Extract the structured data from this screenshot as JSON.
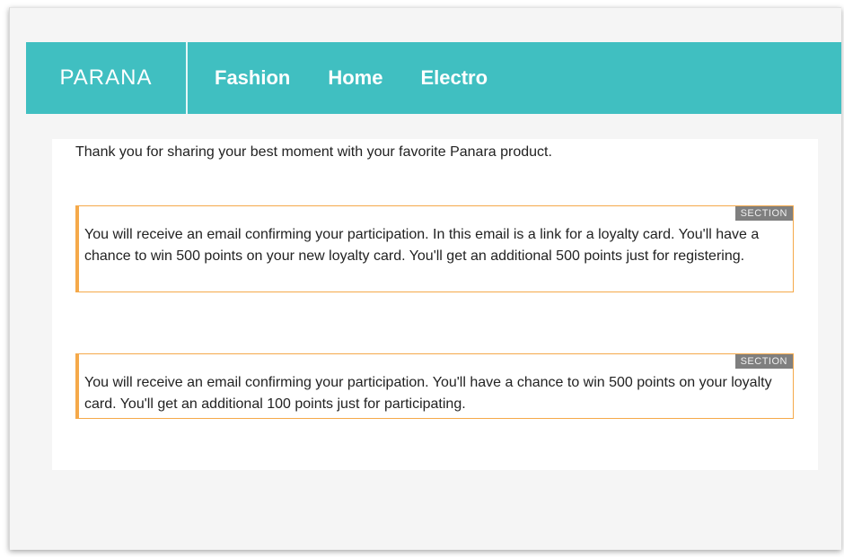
{
  "header": {
    "brand": "PARANA",
    "nav": [
      {
        "label": "Fashion"
      },
      {
        "label": "Home"
      },
      {
        "label": "Electro"
      }
    ]
  },
  "main": {
    "intro": "Thank you for sharing your best moment with your favorite Panara product.",
    "sections": [
      {
        "tag": "SECTION",
        "text": "You will receive an email confirming your participation.  In this email is a link for a loyalty card. You'll have a chance to win 500 points on your new loyalty card.  You'll get an additional 500 points just for registering."
      },
      {
        "tag": "SECTION",
        "text": "You will receive an email confirming your participation. You'll have a chance to win 500 points on your loyalty card.  You'll get an additional 100 points just for participating."
      }
    ]
  },
  "colors": {
    "nav_bg": "#40bfc1",
    "section_border": "#f5a94a",
    "section_tag_bg": "#7f7f7f"
  }
}
